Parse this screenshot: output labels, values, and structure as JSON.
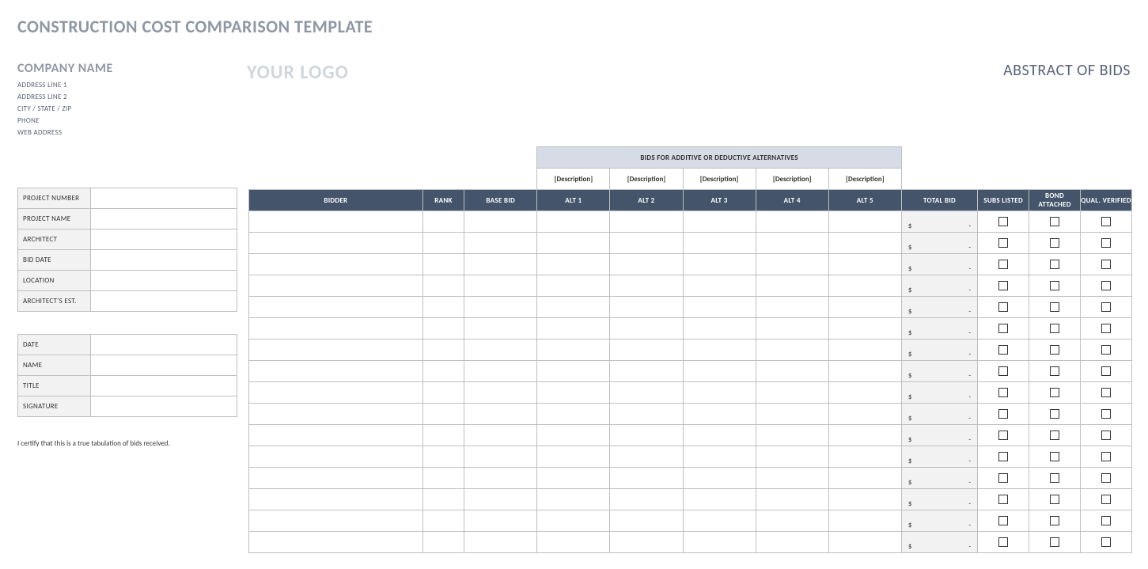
{
  "doc_title": "CONSTRUCTION COST COMPARISON TEMPLATE",
  "company": {
    "name": "COMPANY NAME",
    "lines": [
      "ADDRESS LINE 1",
      "ADDRESS LINE 2",
      "CITY / STATE / ZIP",
      "PHONE",
      "WEB ADDRESS"
    ]
  },
  "logo_text": "YOUR LOGO",
  "abstract_title": "ABSTRACT OF BIDS",
  "project_info_labels": [
    "PROJECT NUMBER",
    "PROJECT NAME",
    "ARCHITECT",
    "BID DATE",
    "LOCATION",
    "ARCHITECT'S EST."
  ],
  "project_info_values": [
    "",
    "",
    "",
    "",
    "",
    ""
  ],
  "sign_info_labels": [
    "DATE",
    "NAME",
    "TITLE",
    "SIGNATURE"
  ],
  "sign_info_values": [
    "",
    "",
    "",
    ""
  ],
  "cert_text": "I certify that this is a true tabulation of bids received.",
  "alternatives_banner": "BIDS FOR ADDITIVE OR DEDUCTIVE ALTERNATIVES",
  "alt_descriptions": [
    "[Description]",
    "[Description]",
    "[Description]",
    "[Description]",
    "[Description]"
  ],
  "headers": {
    "bidder": "BIDDER",
    "rank": "RANK",
    "base_bid": "BASE BID",
    "alts": [
      "ALT 1",
      "ALT 2",
      "ALT 3",
      "ALT 4",
      "ALT 5"
    ],
    "total_bid": "TOTAL BID",
    "subs_listed": "SUBS LISTED",
    "bond_attached": "BOND ATTACHED",
    "qual_verified": "QUAL. VERIFIED"
  },
  "total_bid_currency": "$",
  "total_bid_dash": "-",
  "row_count": 16
}
